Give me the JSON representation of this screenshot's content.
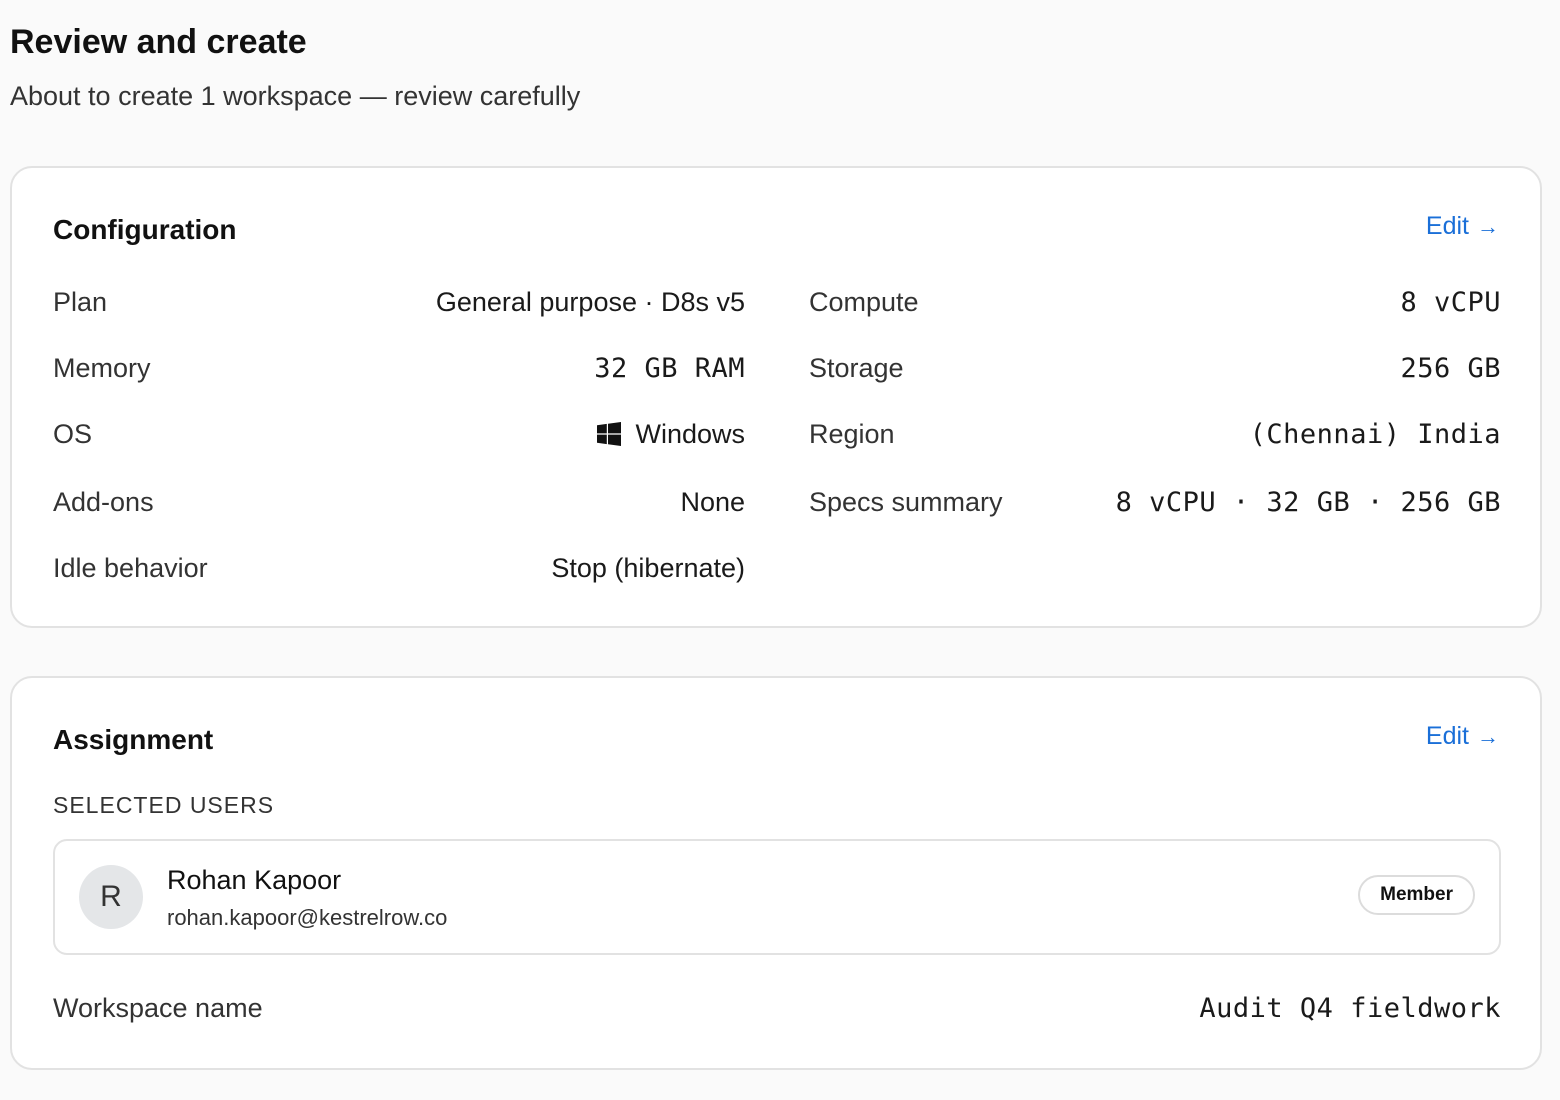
{
  "page": {
    "title": "Review and create",
    "subtitle": "About to create 1 workspace — review carefully"
  },
  "configuration": {
    "title": "Configuration",
    "edit_label": "Edit",
    "edit_arrow": "→",
    "left": [
      {
        "label": "Plan",
        "value": "General purpose · D8s v5"
      },
      {
        "label": "Memory",
        "value": "32 GB RAM"
      },
      {
        "label": "OS",
        "value": "Windows",
        "icon": "windows-logo-icon"
      },
      {
        "label": "Add-ons",
        "value": "None"
      },
      {
        "label": "Idle behavior",
        "value": "Stop (hibernate)"
      }
    ],
    "right": [
      {
        "label": "Compute",
        "value": "8 vCPU"
      },
      {
        "label": "Storage",
        "value": "256 GB"
      },
      {
        "label": "Region",
        "value": "(Chennai) India"
      },
      {
        "label": "Specs summary",
        "value": "8 vCPU · 32 GB · 256 GB"
      }
    ]
  },
  "assignment": {
    "title": "Assignment",
    "edit_label": "Edit",
    "edit_arrow": "→",
    "selected_users_label": "SELECTED USERS",
    "users": [
      {
        "initial": "R",
        "name": "Rohan Kapoor",
        "email": "rohan.kapoor@kestrelrow.co",
        "role": "Member"
      }
    ],
    "workspace_name_label": "Workspace name",
    "workspace_name_value": "Audit Q4 fieldwork"
  },
  "colors": {
    "accent": "#1a6fd8",
    "card_border": "#e2e2e2",
    "background": "#fafafa"
  }
}
